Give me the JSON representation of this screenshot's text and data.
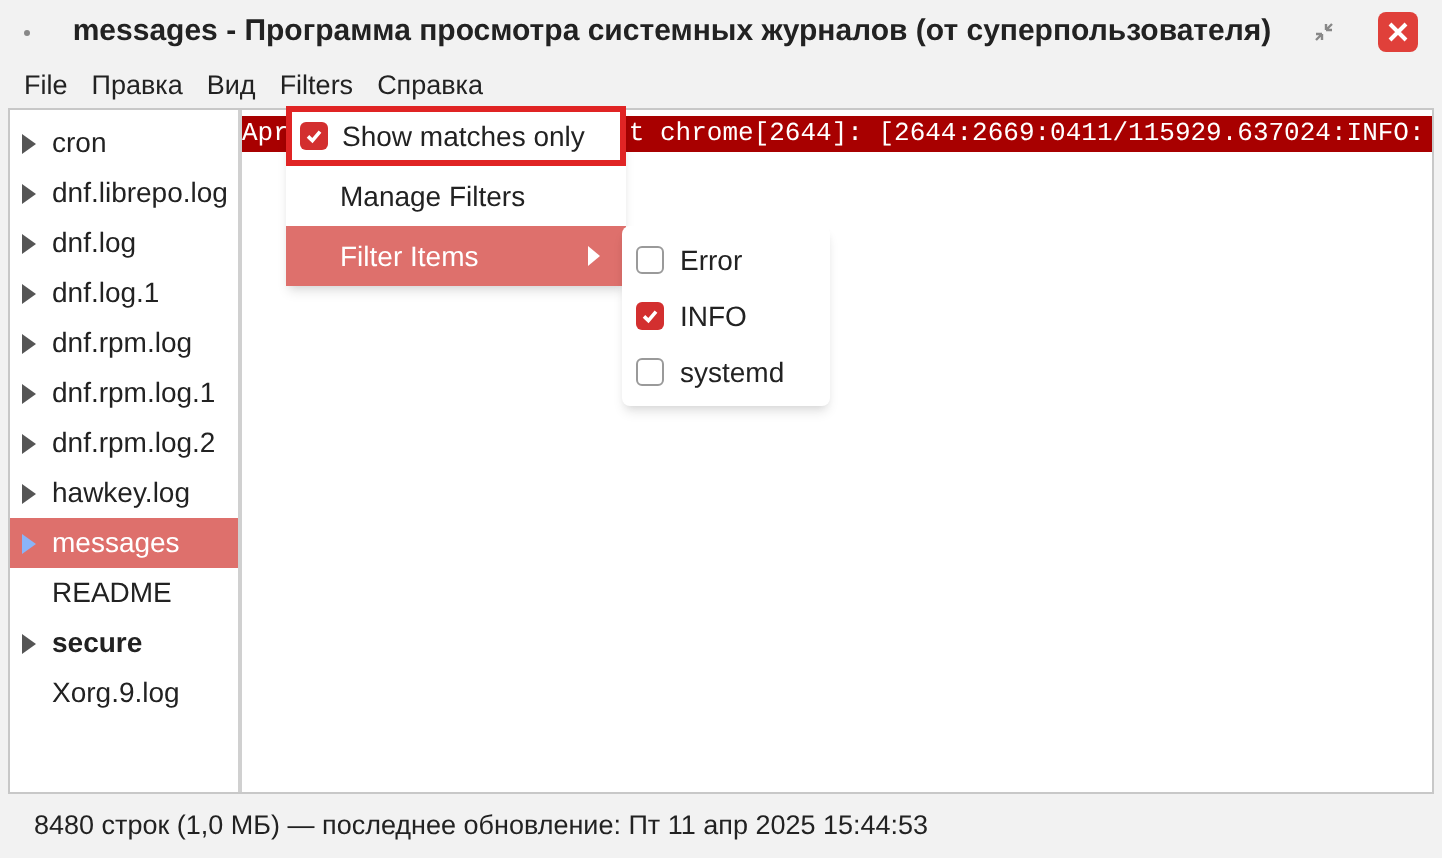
{
  "window": {
    "title": "messages - Программа просмотра системных журналов (от суперпользователя)"
  },
  "menu_bar": [
    {
      "label": "File"
    },
    {
      "label": "Правка"
    },
    {
      "label": "Вид"
    },
    {
      "label": "Filters"
    },
    {
      "label": "Справка"
    }
  ],
  "sidebar": {
    "items": [
      {
        "label": "cron",
        "expandable": true,
        "selected": false,
        "bold": false
      },
      {
        "label": "dnf.librepo.log",
        "expandable": true,
        "selected": false,
        "bold": false
      },
      {
        "label": "dnf.log",
        "expandable": true,
        "selected": false,
        "bold": false
      },
      {
        "label": "dnf.log.1",
        "expandable": true,
        "selected": false,
        "bold": false
      },
      {
        "label": "dnf.rpm.log",
        "expandable": true,
        "selected": false,
        "bold": false
      },
      {
        "label": "dnf.rpm.log.1",
        "expandable": true,
        "selected": false,
        "bold": false
      },
      {
        "label": "dnf.rpm.log.2",
        "expandable": true,
        "selected": false,
        "bold": false
      },
      {
        "label": "hawkey.log",
        "expandable": true,
        "selected": false,
        "bold": false
      },
      {
        "label": "messages",
        "expandable": true,
        "selected": true,
        "bold": false
      },
      {
        "label": "README",
        "expandable": false,
        "selected": false,
        "bold": false
      },
      {
        "label": "secure",
        "expandable": true,
        "selected": false,
        "bold": true
      },
      {
        "label": "Xorg.9.log",
        "expandable": false,
        "selected": false,
        "bold": false
      }
    ]
  },
  "log": {
    "line_start": "Apr",
    "line_rest": "t chrome[2644]: [2644:2669:0411/115929.637024:INFO:"
  },
  "filters_menu": [
    {
      "kind": "check",
      "label": "Show matches only",
      "checked": true,
      "highlighted": false,
      "outlined": true
    },
    {
      "kind": "plain",
      "label": "Manage Filters",
      "highlighted": false,
      "outlined": false
    },
    {
      "kind": "submenu",
      "label": "Filter Items",
      "highlighted": true,
      "outlined": false
    }
  ],
  "filter_items": [
    {
      "label": "Error",
      "checked": false
    },
    {
      "label": "INFO",
      "checked": true
    },
    {
      "label": "systemd",
      "checked": false
    }
  ],
  "status_bar": "8480 строк (1,0 МБ) — последнее обновление: Пт 11 апр 2025 15:44:53"
}
